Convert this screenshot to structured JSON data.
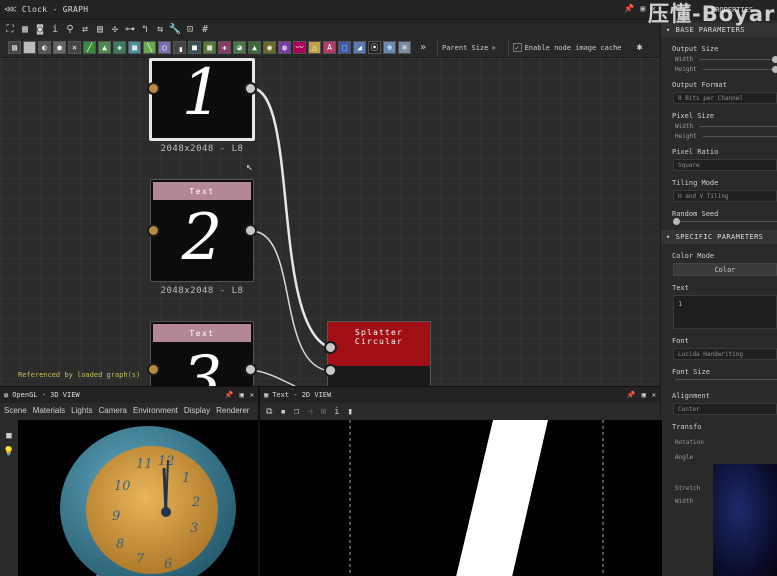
{
  "graph": {
    "title": "Clock - GRAPH",
    "parent_size_label": "Parent Size",
    "enable_cache_label": "Enable node image cache",
    "referenced_note": "Referenced by loaded graph(s)",
    "nodes": [
      {
        "header": "",
        "digit": "1",
        "caption": "2048x2048 - L8"
      },
      {
        "header": "Text",
        "digit": "2",
        "caption": "2048x2048 - L8"
      },
      {
        "header": "Text",
        "digit": "3",
        "caption": ""
      }
    ],
    "splatter_node": {
      "header": "Splatter Circular"
    }
  },
  "properties": {
    "title": "PROPERTIES",
    "base_section": "BASE PARAMETERS",
    "output_size": "Output Size",
    "width": "Width",
    "height": "Height",
    "output_format": "Output Format",
    "output_format_value": "8 Bits per Channel",
    "pixel_size": "Pixel Size",
    "pixel_ratio": "Pixel Ratio",
    "pixel_ratio_value": "Square",
    "tiling_mode": "Tiling Mode",
    "tiling_mode_value": "H and V Tiling",
    "random_seed": "Random Seed",
    "specific_section": "SPECIFIC PARAMETERS",
    "color_mode": "Color Mode",
    "color_mode_value": "Color",
    "text_label": "Text",
    "text_value": "1",
    "font_label": "Font",
    "font_value": "Lucida Handwriting",
    "font_size_label": "Font Size",
    "alignment_label": "Alignment",
    "alignment_value": "Center",
    "transform_label": "Transfo",
    "rotation_label": "Rotation",
    "angle_label": "Angle",
    "stretch_label": "Stretch",
    "width2_label": "Width"
  },
  "watermark": "压懂-Boyar",
  "view3d": {
    "title": "OpenGL - 3D VIEW",
    "menu": [
      "Scene",
      "Materials",
      "Lights",
      "Camera",
      "Environment",
      "Display",
      "Renderer"
    ]
  },
  "view2d": {
    "title": "Text - 2D VIEW"
  },
  "colors": {
    "node_header": "#b38795",
    "splatter_header": "#a10f14",
    "input_port": "#b8893f",
    "output_port": "#c9c9c9",
    "clock_body": "#3e7f96",
    "clock_face": "#d9a24a"
  }
}
